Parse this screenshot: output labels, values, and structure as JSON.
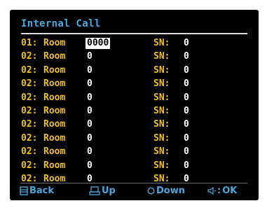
{
  "screen": {
    "title": "Internal Call"
  },
  "rows": [
    {
      "num": "01:",
      "room": "Room",
      "value": "0000",
      "sn_label": "SN:",
      "sn_value": "0",
      "selected": true
    },
    {
      "num": "02:",
      "room": "Room",
      "value": "0",
      "sn_label": "SN:",
      "sn_value": "0"
    },
    {
      "num": "02:",
      "room": "Room",
      "value": "0",
      "sn_label": "SN:",
      "sn_value": "0"
    },
    {
      "num": "02:",
      "room": "Room",
      "value": "0",
      "sn_label": "SN:",
      "sn_value": "0"
    },
    {
      "num": "02:",
      "room": "Room",
      "value": "0",
      "sn_label": "SN:",
      "sn_value": "0"
    },
    {
      "num": "02:",
      "room": "Room",
      "value": "0",
      "sn_label": "SN:",
      "sn_value": "0"
    },
    {
      "num": "02:",
      "room": "Room",
      "value": "0",
      "sn_label": "SN:",
      "sn_value": "0"
    },
    {
      "num": "02:",
      "room": "Room",
      "value": "0",
      "sn_label": "SN:",
      "sn_value": "0"
    },
    {
      "num": "02:",
      "room": "Room",
      "value": "0",
      "sn_label": "SN:",
      "sn_value": "0"
    },
    {
      "num": "02:",
      "room": "Room",
      "value": "0",
      "sn_label": "SN:",
      "sn_value": "0"
    },
    {
      "num": "02:",
      "room": "Room",
      "value": "0",
      "sn_label": "SN:",
      "sn_value": "0"
    }
  ],
  "footer": {
    "back_label": "Back",
    "up_label": "Up",
    "down_label": "Down",
    "ok_label": "OK",
    "back_icon": "back-key-icon",
    "up_icon": "up-key-icon",
    "down_icon": "down-key-icon",
    "ok_icon": "ok-key-icon"
  },
  "colors": {
    "background": "#000000",
    "title": "#49a9e0",
    "label": "#f1c21b",
    "value": "#ffffff",
    "footer": "#49a9e0"
  }
}
